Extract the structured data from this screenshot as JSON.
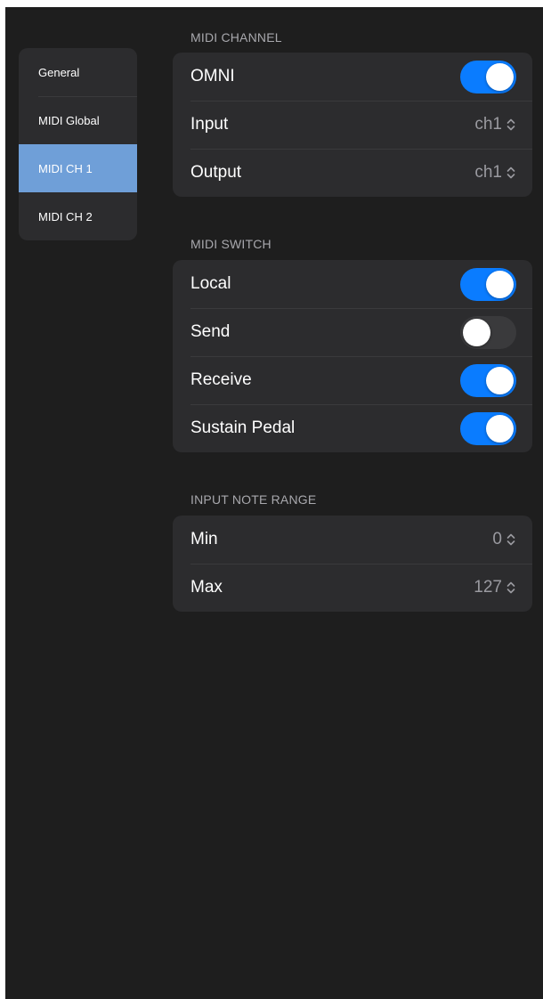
{
  "colors": {
    "background": "#1e1e1e",
    "card": "#2c2c2e",
    "separator": "#3a3a3c",
    "accent": "#0a7cff",
    "selected": "#6f9fd8",
    "secondary_text": "#a8a8ad"
  },
  "sidebar": {
    "items": [
      {
        "label": "General",
        "selected": false
      },
      {
        "label": "MIDI Global",
        "selected": false
      },
      {
        "label": "MIDI CH 1",
        "selected": true
      },
      {
        "label": "MIDI CH 2",
        "selected": false
      }
    ]
  },
  "midi_channel": {
    "header": "MIDI CHANNEL",
    "omni": {
      "label": "OMNI",
      "on": true
    },
    "input": {
      "label": "Input",
      "value": "ch1",
      "icon": "chevron-up-down-icon"
    },
    "output": {
      "label": "Output",
      "value": "ch1",
      "icon": "chevron-up-down-icon"
    }
  },
  "midi_switch": {
    "header": "MIDI SWITCH",
    "local": {
      "label": "Local",
      "on": true
    },
    "send": {
      "label": "Send",
      "on": false
    },
    "receive": {
      "label": "Receive",
      "on": true
    },
    "sustain_pedal": {
      "label": "Sustain Pedal",
      "on": true
    }
  },
  "input_note_range": {
    "header": "INPUT NOTE RANGE",
    "min": {
      "label": "Min",
      "value": "0",
      "icon": "chevron-up-down-icon"
    },
    "max": {
      "label": "Max",
      "value": "127",
      "icon": "chevron-up-down-icon"
    }
  }
}
